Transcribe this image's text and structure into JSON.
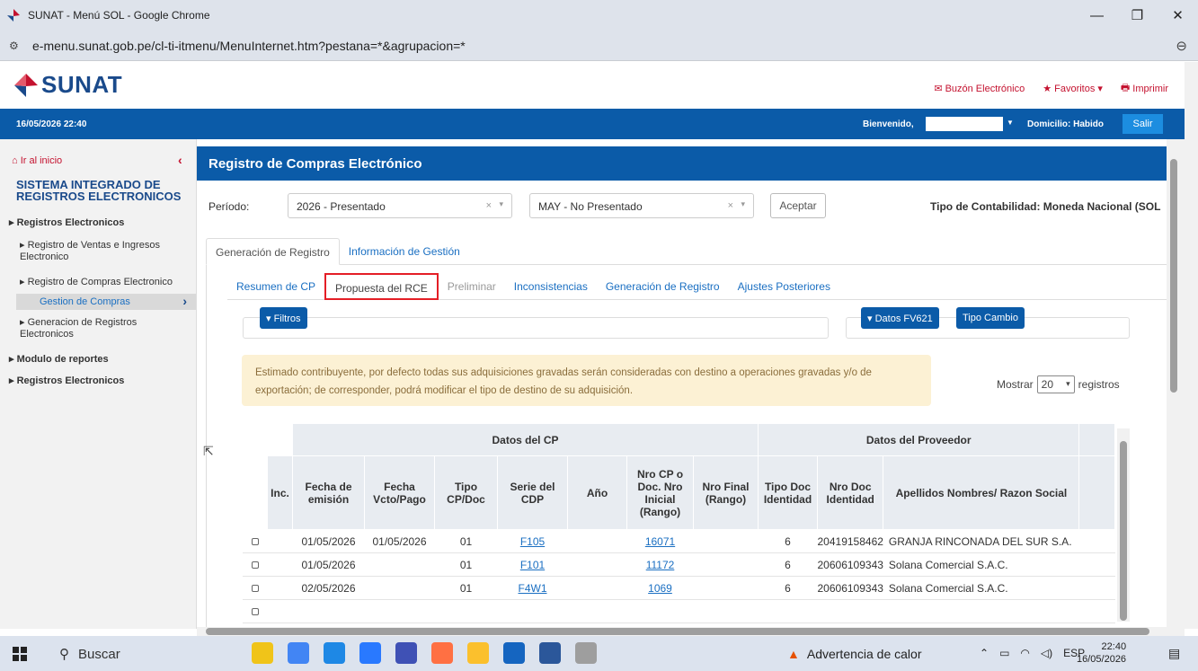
{
  "browser": {
    "window_title": "SUNAT - Menú SOL - Google Chrome",
    "url": "e-menu.sunat.gob.pe/cl-ti-itmenu/MenuInternet.htm?pestana=*&agrupacion=*",
    "minimize": "—",
    "restore": "❐",
    "close": "✕",
    "zoom": "⊖"
  },
  "header": {
    "logo_text": "SUNAT",
    "links": {
      "buzon": "Buzón Electrónico",
      "favoritos": "Favoritos",
      "imprimir": "Imprimir"
    },
    "date_time": "16/05/2026 22:40",
    "welcome": "Bienvenido,",
    "domicilio": "Domicilio: Habido",
    "salir": "Salir"
  },
  "sidebar": {
    "home": "Ir al inicio",
    "system_line1": "SISTEMA INTEGRADO DE",
    "system_line2": "REGISTROS ELECTRONICOS",
    "items": [
      "Registros Electronicos",
      "Registro de Ventas e Ingresos",
      "Electronico",
      "Registro de Compras Electronico",
      "Gestion de Compras",
      "Generacion de Registros",
      "Electronicos",
      "Modulo de reportes",
      "Registros Electronicos"
    ]
  },
  "main": {
    "title": "Registro de Compras Electrónico",
    "period_label": "Período:",
    "year_select": "2026 - Presentado",
    "month_select": "MAY - No Presentado",
    "aceptar": "Aceptar",
    "tipo_contabilidad": "Tipo de Contabilidad: Moneda Nacional (SOL",
    "tabs": [
      "Generación de Registro",
      "Información de Gestión"
    ],
    "subtabs": [
      "Resumen de CP",
      "Propuesta del RCE",
      "Preliminar",
      "Inconsistencias",
      "Generación de Registro",
      "Ajustes Posteriores"
    ],
    "filtros": "▾ Filtros",
    "datos_fv": "▾ Datos FV621",
    "tipo_cambio": "Tipo Cambio",
    "notice_line1": "Estimado contribuyente, por defecto todas sus adquisiciones gravadas serán consideradas con destino a operaciones gravadas y/o de",
    "notice_line2": "exportación; de corresponder, podrá modificar el tipo de destino de su adquisición.",
    "mostrar": "Mostrar",
    "mostrar_value": "20",
    "registros": "registros"
  },
  "table": {
    "group_cp": "Datos del CP",
    "group_prov": "Datos del Proveedor",
    "columns": {
      "inc": "Inc.",
      "fecha_emision": "Fecha de emisión",
      "fecha_vcto": "Fecha Vcto/Pago",
      "tipo_cp": "Tipo CP/Doc",
      "serie": "Serie del CDP",
      "anio": "Año",
      "nro_cp": "Nro CP o Doc. Nro Inicial (Rango)",
      "nro_final": "Nro Final (Rango)",
      "tipo_doc": "Tipo Doc Identidad",
      "nro_doc": "Nro Doc Identidad",
      "razon": "Apellidos Nombres/ Razon Social"
    },
    "rows": [
      {
        "fecha_emision": "01/05/2026",
        "fecha_vcto": "01/05/2026",
        "tipo_cp": "01",
        "serie": "F105",
        "anio": "",
        "nro_cp": "16071",
        "nro_final": "",
        "tipo_doc": "6",
        "nro_doc": "20419158462",
        "razon": "GRANJA RINCONADA DEL SUR S.A."
      },
      {
        "fecha_emision": "01/05/2026",
        "fecha_vcto": "",
        "tipo_cp": "01",
        "serie": "F101",
        "anio": "",
        "nro_cp": "11172",
        "nro_final": "",
        "tipo_doc": "6",
        "nro_doc": "20606109343",
        "razon": "Solana Comercial S.A.C."
      },
      {
        "fecha_emision": "02/05/2026",
        "fecha_vcto": "",
        "tipo_cp": "01",
        "serie": "F4W1",
        "anio": "",
        "nro_cp": "1069",
        "nro_final": "",
        "tipo_doc": "6",
        "nro_doc": "20606109343",
        "razon": "Solana Comercial S.A.C."
      }
    ]
  },
  "taskbar": {
    "search": "Buscar",
    "warning": "Advertencia de calor",
    "lang": "ESP",
    "time": "22:40",
    "date": "16/05/2026"
  }
}
